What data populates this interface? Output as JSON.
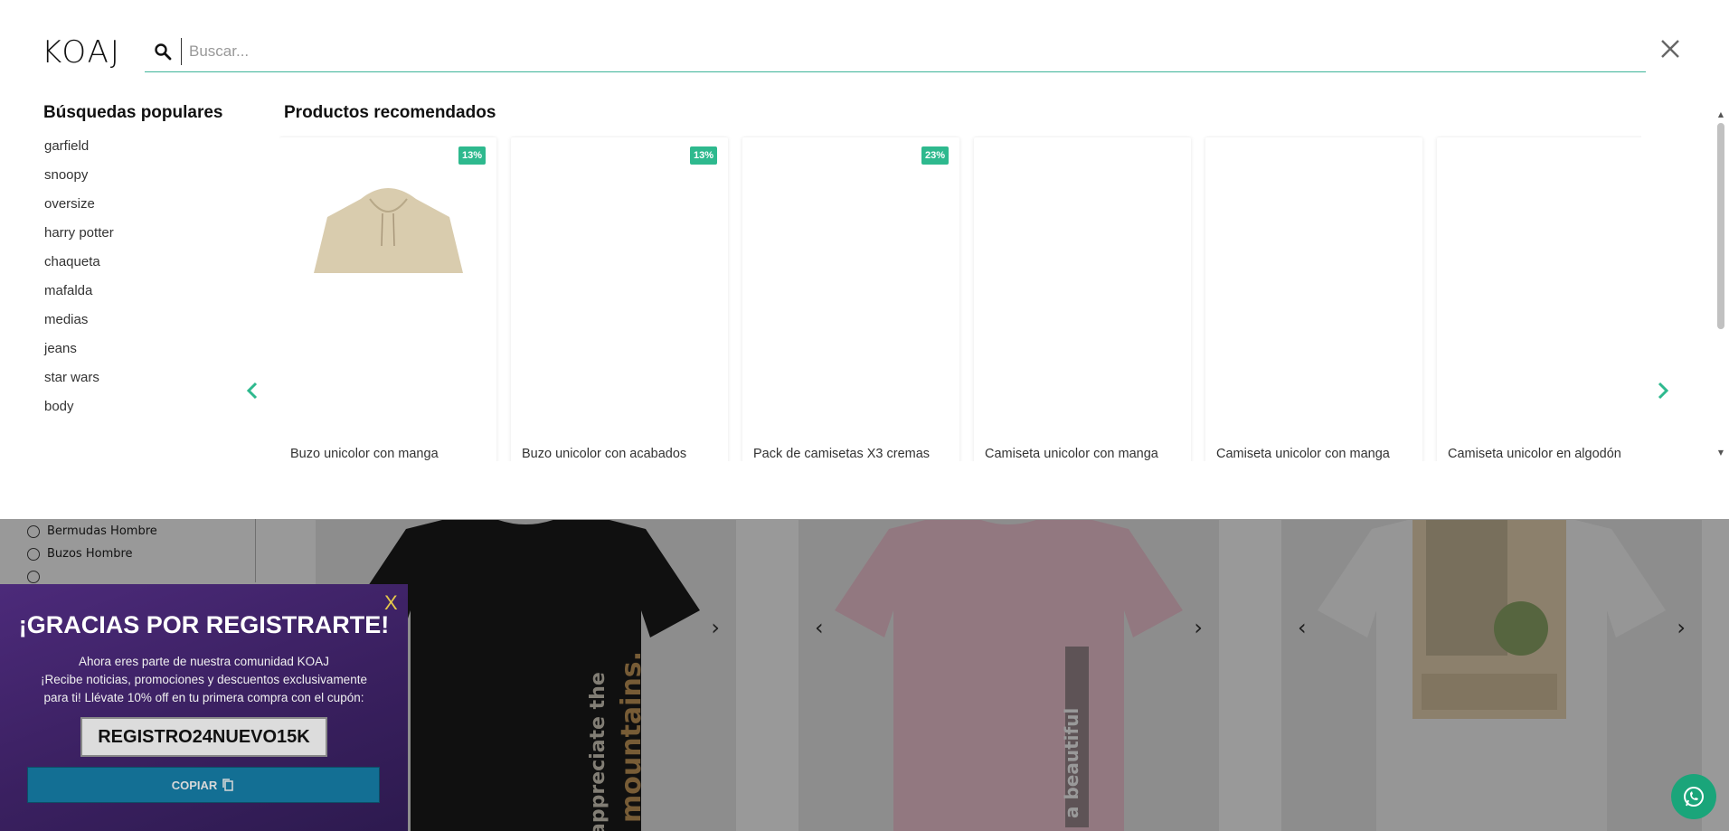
{
  "header": {
    "logo": "KOAJ",
    "search_placeholder": "Buscar..."
  },
  "popular": {
    "title": "Búsquedas populares",
    "items": [
      "garfield",
      "snoopy",
      "oversize",
      "harry potter",
      "chaqueta",
      "mafalda",
      "medias",
      "jeans",
      "star wars",
      "body"
    ]
  },
  "recommended": {
    "title": "Productos recomendados",
    "products": [
      {
        "name": "Buzo unicolor con manga",
        "badge": "13%"
      },
      {
        "name": "Buzo unicolor con acabados",
        "badge": "13%"
      },
      {
        "name": "Pack de camisetas X3 cremas",
        "badge": "23%"
      },
      {
        "name": "Camiseta unicolor con manga",
        "badge": ""
      },
      {
        "name": "Camiseta unicolor con manga",
        "badge": ""
      },
      {
        "name": "Camiseta unicolor en algodón",
        "badge": ""
      }
    ]
  },
  "background": {
    "filters": [
      "Bermudas Hombre",
      "Buzos Hombre"
    ],
    "prints": [
      "appreciate the",
      "mountains.",
      "a beautiful"
    ]
  },
  "promo": {
    "close": "X",
    "title": "¡GRACIAS POR REGISTRARTE!",
    "line1": "Ahora eres parte de nuestra comunidad KOAJ",
    "line2": "¡Recibe noticias, promociones y descuentos exclusivamente",
    "line3": "para ti! Llévate 10% off en tu primera compra con el cupón:",
    "code": "REGISTRO24NUEVO15K",
    "copy_label": "COPIAR"
  },
  "colors": {
    "accent": "#2eb98e",
    "promo_bg": "#3a2060",
    "copy_button": "#136f94",
    "whatsapp": "#1aa57a"
  },
  "icons": {
    "search": "search-icon",
    "close": "close-icon",
    "prev": "chevron-left-icon",
    "next": "chevron-right-icon",
    "copy": "copy-icon",
    "whatsapp": "whatsapp-icon"
  }
}
